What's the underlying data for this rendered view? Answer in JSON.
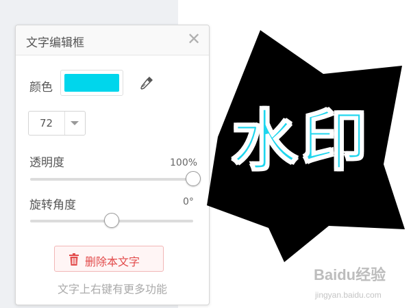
{
  "panel": {
    "title": "文字编辑框",
    "close_glyph": "✕",
    "color_label": "颜色",
    "color_value": "#00d6ec",
    "font_size": "72",
    "opacity_label": "透明度",
    "opacity_value": "100%",
    "opacity_fraction": 1.0,
    "rotation_label": "旋转角度",
    "rotation_value": "0°",
    "rotation_fraction": 0.5,
    "delete_label": "删除本文字",
    "hint": "文字上右键有更多功能"
  },
  "canvas": {
    "watermark_text": "水印",
    "watermark_color": "#1fd6ee",
    "shape_color": "#000000"
  },
  "logo": {
    "name": "Baidu经验",
    "url_text": "jingyan.baidu.com"
  },
  "icons": [
    "close-icon",
    "eyedropper-icon",
    "chevron-down-icon",
    "trash-icon"
  ]
}
